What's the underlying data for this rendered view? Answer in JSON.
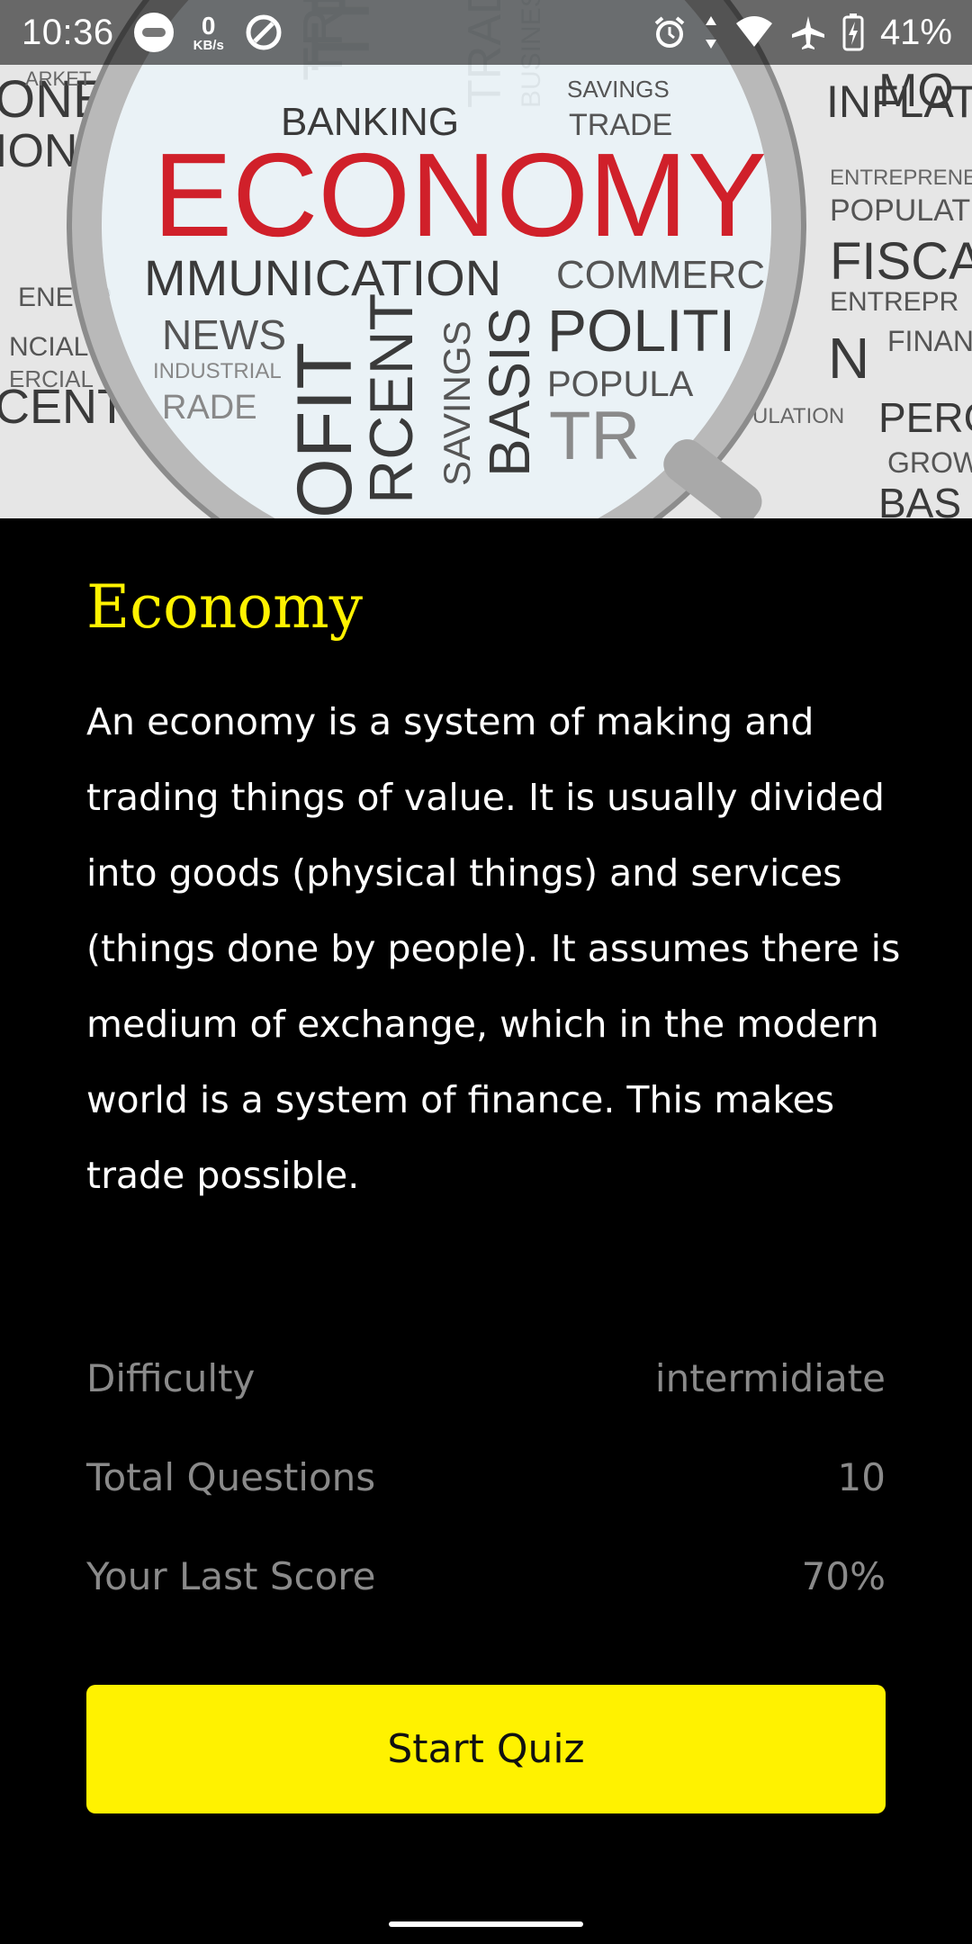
{
  "status_bar": {
    "time": "10:36",
    "net_speed_value": "0",
    "net_speed_unit": "KB/s",
    "battery_percent": "41%"
  },
  "hero": {
    "image_words": {
      "main": "ECONOMY",
      "banking": "BANKING",
      "communication": "MMUNICATION",
      "commerce": "COMMERC",
      "news": "NEWS",
      "polit": "POLITI",
      "popul": "POPULA",
      "inflat": "INFLAT",
      "fisca": "FISCA",
      "savings": "SAVINGS",
      "trade": "TRADE",
      "basis": "BASIS",
      "ofit": "OFIT",
      "rcent": "RCENT",
      "entrepre": "ENTREPRENE",
      "population": "POPULATIO",
      "finan": "FINAN",
      "perc": "PERC",
      "grow": "GROW",
      "bas": "BAS",
      "one": "ONE",
      "ion": "ION",
      "cent": "CENT",
      "tr": "TR"
    }
  },
  "quiz": {
    "title": "Economy",
    "description": "An economy is a system of making and trading things of value. It is usually divided into goods (physical things) and services (things done by people). It assumes there is medium of exchange, which in the modern world is a system of finance. This makes trade possible.",
    "stats": [
      {
        "label": "Difficulty",
        "value": "intermidiate"
      },
      {
        "label": "Total Questions",
        "value": "10"
      },
      {
        "label": "Your Last Score",
        "value": "70%"
      }
    ],
    "start_label": "Start Quiz"
  },
  "colors": {
    "accent": "#fff200",
    "background": "#000000",
    "muted_text": "#8a8a8a",
    "hero_red": "#d0202a"
  }
}
